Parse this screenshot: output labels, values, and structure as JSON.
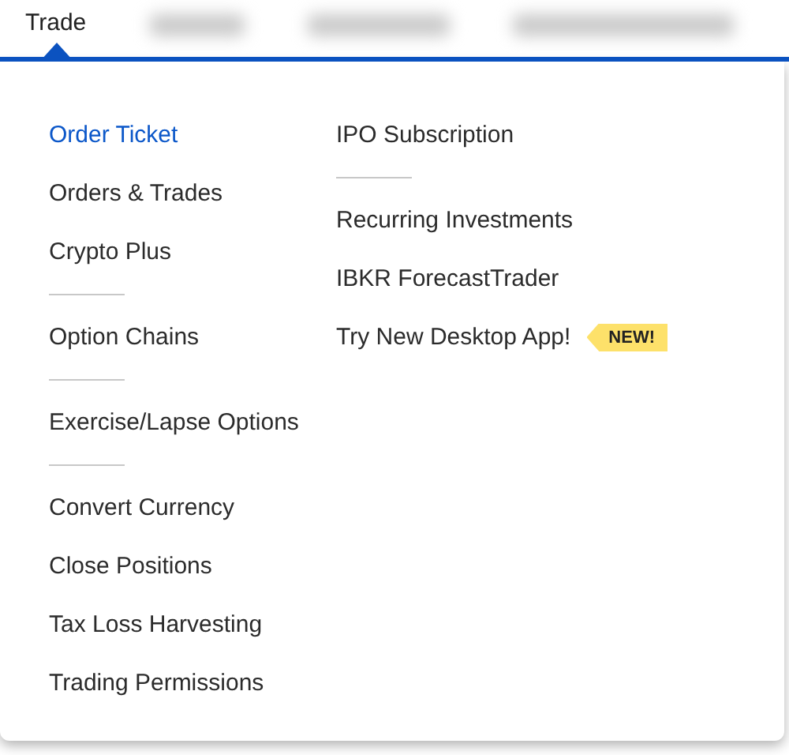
{
  "nav": {
    "tabs": [
      {
        "label": "Trade",
        "selected": true
      }
    ]
  },
  "menu": {
    "columns": [
      {
        "items": [
          {
            "kind": "link",
            "label": "Order Ticket",
            "selected": true
          },
          {
            "kind": "link",
            "label": "Orders & Trades",
            "selected": false
          },
          {
            "kind": "link",
            "label": "Crypto Plus",
            "selected": false
          },
          {
            "kind": "divider"
          },
          {
            "kind": "link",
            "label": "Option Chains",
            "selected": false
          },
          {
            "kind": "divider"
          },
          {
            "kind": "link",
            "label": "Exercise/Lapse Options",
            "selected": false
          },
          {
            "kind": "divider"
          },
          {
            "kind": "link",
            "label": "Convert Currency",
            "selected": false
          },
          {
            "kind": "link",
            "label": "Close Positions",
            "selected": false
          },
          {
            "kind": "link",
            "label": "Tax Loss Harvesting",
            "selected": false
          },
          {
            "kind": "link",
            "label": "Trading Permissions",
            "selected": false
          }
        ]
      },
      {
        "items": [
          {
            "kind": "link",
            "label": "IPO Subscription",
            "selected": false
          },
          {
            "kind": "divider"
          },
          {
            "kind": "link",
            "label": "Recurring Investments",
            "selected": false
          },
          {
            "kind": "link",
            "label": "IBKR ForecastTrader",
            "selected": false
          },
          {
            "kind": "link",
            "label": "Try New Desktop App!",
            "selected": false,
            "badge": "NEW!"
          }
        ]
      }
    ]
  }
}
